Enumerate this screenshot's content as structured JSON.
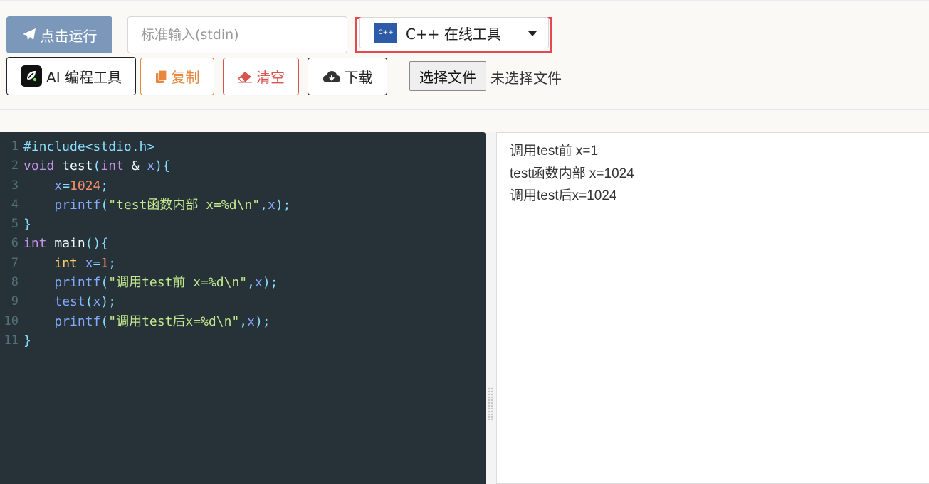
{
  "toolbar": {
    "run_label": "点击运行",
    "stdin_placeholder": "标准输入(stdin)",
    "language": {
      "logo_text": "C++",
      "label": "C++ 在线工具"
    },
    "ai_label": "AI 编程工具",
    "copy_label": "复制",
    "clear_label": "清空",
    "download_label": "下载",
    "choose_file_label": "选择文件",
    "file_status": "未选择文件"
  },
  "colors": {
    "run_button": "#7b97b9",
    "copy_accent": "#e8873e",
    "clear_accent": "#d9534f",
    "highlight_box": "#e8474d",
    "editor_bg": "#263238"
  },
  "editor": {
    "line_numbers": [
      "1",
      "2",
      "3",
      "4",
      "5",
      "6",
      "7",
      "8",
      "9",
      "10",
      "11"
    ],
    "lines": [
      [
        {
          "t": "#include<stdio.h>",
          "c": "c-pre"
        }
      ],
      [
        {
          "t": "void",
          "c": "c-kw"
        },
        {
          "t": " test",
          "c": "c-p"
        },
        {
          "t": "(",
          "c": "c-br"
        },
        {
          "t": "int",
          "c": "c-kw"
        },
        {
          "t": " & ",
          "c": "c-p"
        },
        {
          "t": "x",
          "c": "c-var"
        },
        {
          "t": "){",
          "c": "c-br"
        }
      ],
      [
        {
          "t": "    ",
          "c": "c-p"
        },
        {
          "t": "x",
          "c": "c-var"
        },
        {
          "t": "=",
          "c": "c-br"
        },
        {
          "t": "1024",
          "c": "c-num"
        },
        {
          "t": ";",
          "c": "c-br"
        }
      ],
      [
        {
          "t": "    ",
          "c": "c-p"
        },
        {
          "t": "printf",
          "c": "c-fn"
        },
        {
          "t": "(",
          "c": "c-br"
        },
        {
          "t": "\"test函数内部 x=%d\\n\"",
          "c": "c-str"
        },
        {
          "t": ",",
          "c": "c-br"
        },
        {
          "t": "x",
          "c": "c-var"
        },
        {
          "t": ");",
          "c": "c-br"
        }
      ],
      [
        {
          "t": "}",
          "c": "c-br"
        }
      ],
      [
        {
          "t": "int",
          "c": "c-kw"
        },
        {
          "t": " main",
          "c": "c-p"
        },
        {
          "t": "(){",
          "c": "c-br"
        }
      ],
      [
        {
          "t": "    ",
          "c": "c-p"
        },
        {
          "t": "int",
          "c": "c-kw2"
        },
        {
          "t": " ",
          "c": "c-p"
        },
        {
          "t": "x",
          "c": "c-var"
        },
        {
          "t": "=",
          "c": "c-br"
        },
        {
          "t": "1",
          "c": "c-num"
        },
        {
          "t": ";",
          "c": "c-br"
        }
      ],
      [
        {
          "t": "    ",
          "c": "c-p"
        },
        {
          "t": "printf",
          "c": "c-fn"
        },
        {
          "t": "(",
          "c": "c-br"
        },
        {
          "t": "\"调用test前 x=%d\\n\"",
          "c": "c-str"
        },
        {
          "t": ",",
          "c": "c-br"
        },
        {
          "t": "x",
          "c": "c-var"
        },
        {
          "t": ");",
          "c": "c-br"
        }
      ],
      [
        {
          "t": "    ",
          "c": "c-p"
        },
        {
          "t": "test",
          "c": "c-fn"
        },
        {
          "t": "(",
          "c": "c-br"
        },
        {
          "t": "x",
          "c": "c-var"
        },
        {
          "t": ");",
          "c": "c-br"
        }
      ],
      [
        {
          "t": "    ",
          "c": "c-p"
        },
        {
          "t": "printf",
          "c": "c-fn"
        },
        {
          "t": "(",
          "c": "c-br"
        },
        {
          "t": "\"调用test后x=%d\\n\"",
          "c": "c-str"
        },
        {
          "t": ",",
          "c": "c-br"
        },
        {
          "t": "x",
          "c": "c-var"
        },
        {
          "t": ");",
          "c": "c-br"
        }
      ],
      [
        {
          "t": "}",
          "c": "c-br"
        }
      ]
    ]
  },
  "output": {
    "lines": [
      "调用test前 x=1",
      "test函数内部 x=1024",
      "调用test后x=1024"
    ]
  }
}
